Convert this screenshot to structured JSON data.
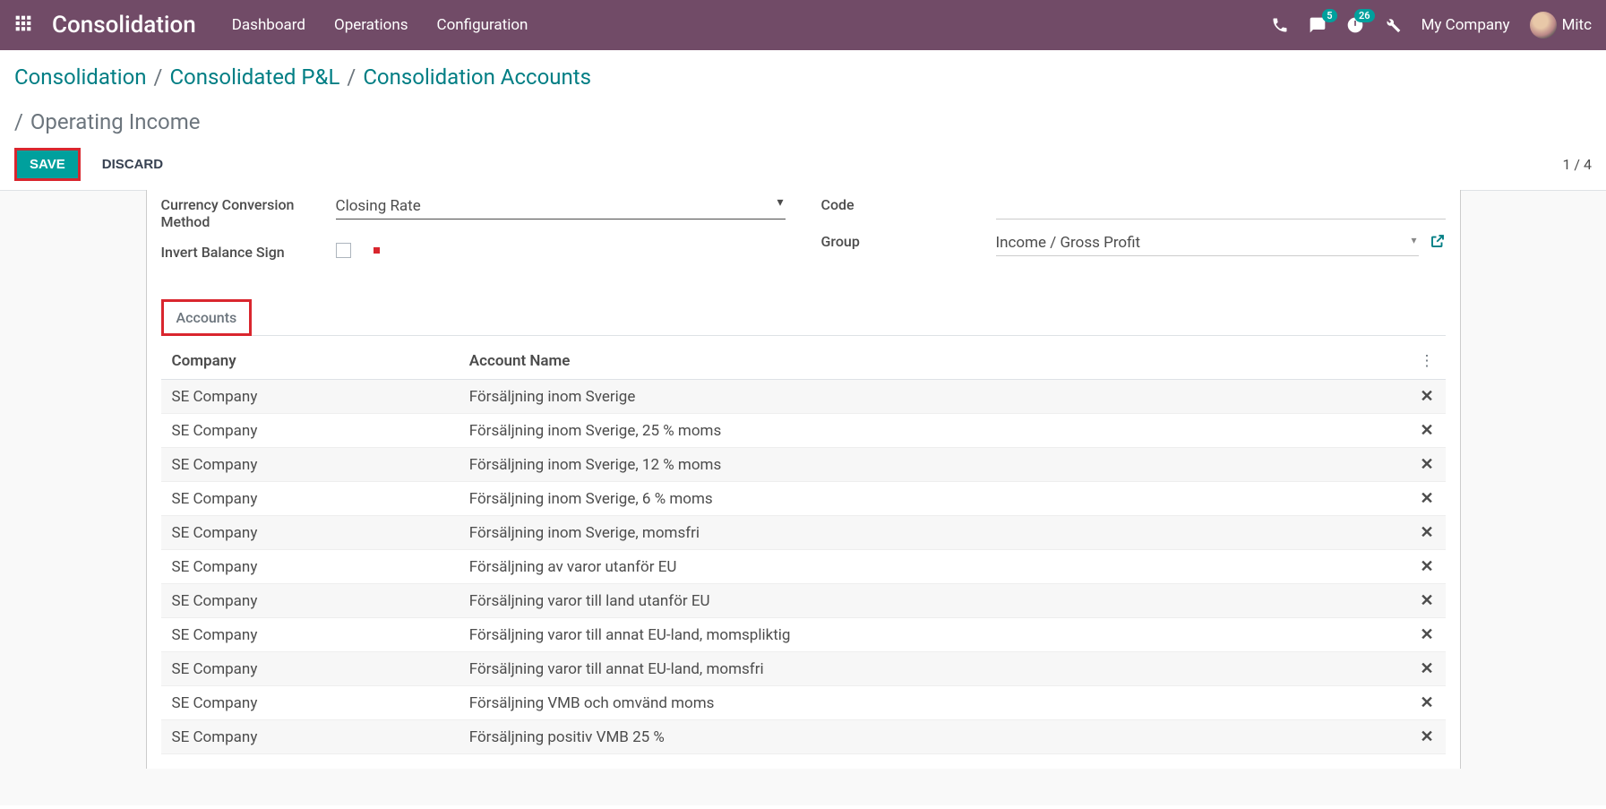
{
  "topnav": {
    "brand": "Consolidation",
    "menu": [
      "Dashboard",
      "Operations",
      "Configuration"
    ],
    "messages_badge": "5",
    "activities_badge": "26",
    "company": "My Company",
    "user_name": "Mitc"
  },
  "breadcrumb": {
    "items": [
      "Consolidation",
      "Consolidated P&L",
      "Consolidation Accounts"
    ],
    "current": "Operating Income"
  },
  "buttons": {
    "save": "SAVE",
    "discard": "DISCARD"
  },
  "pager": "1 / 4",
  "form": {
    "currency_method_label": "Currency Conversion Method",
    "currency_method_value": "Closing Rate",
    "invert_label": "Invert Balance Sign",
    "code_label": "Code",
    "code_value": "",
    "group_label": "Group",
    "group_value": "Income / Gross Profit"
  },
  "tabs": {
    "accounts": "Accounts"
  },
  "table": {
    "columns": [
      "Company",
      "Account Name"
    ],
    "rows": [
      {
        "company": "SE Company",
        "account": "Försäljning inom Sverige"
      },
      {
        "company": "SE Company",
        "account": "Försäljning inom Sverige, 25 % moms"
      },
      {
        "company": "SE Company",
        "account": "Försäljning inom Sverige, 12 % moms"
      },
      {
        "company": "SE Company",
        "account": "Försäljning inom Sverige, 6 % moms"
      },
      {
        "company": "SE Company",
        "account": "Försäljning inom Sverige, momsfri"
      },
      {
        "company": "SE Company",
        "account": "Försäljning av varor utanför EU"
      },
      {
        "company": "SE Company",
        "account": "Försäljning varor till land utanför EU"
      },
      {
        "company": "SE Company",
        "account": "Försäljning varor till annat EU-land, momspliktig"
      },
      {
        "company": "SE Company",
        "account": "Försäljning varor till annat EU-land, momsfri"
      },
      {
        "company": "SE Company",
        "account": "Försäljning VMB och omvänd moms"
      },
      {
        "company": "SE Company",
        "account": "Försäljning positiv VMB 25 %"
      }
    ]
  }
}
